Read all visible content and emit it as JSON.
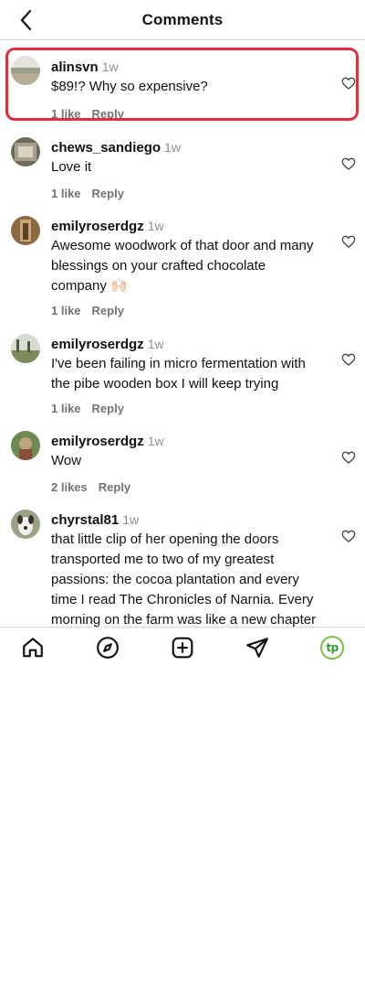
{
  "header": {
    "title": "Comments"
  },
  "comments": [
    {
      "username": "alinsvn",
      "time": "1w",
      "text": "$89!? Why so expensive?",
      "likes": "1 like",
      "reply": "Reply"
    },
    {
      "username": "chews_sandiego",
      "time": "1w",
      "text": "Love it",
      "likes": "1 like",
      "reply": "Reply"
    },
    {
      "username": "emilyroserdgz",
      "time": "1w",
      "text": "Awesome woodwork of that door and many blessings on your crafted chocolate company 🙌🏻",
      "likes": "1 like",
      "reply": "Reply"
    },
    {
      "username": "emilyroserdgz",
      "time": "1w",
      "text": "I've been failing in micro fermentation with the pibe wooden box I will keep trying",
      "likes": "1 like",
      "reply": "Reply"
    },
    {
      "username": "emilyroserdgz",
      "time": "1w",
      "text": "Wow",
      "likes": "2 likes",
      "reply": "Reply"
    },
    {
      "username": "chyrstal81",
      "time": "1w",
      "text": "that little clip of her opening the doors transported me to two of my greatest passions: the cocoa plantation and every time I read The Chronicles of Narnia. Every morning on the farm was like a new chapter while I'm on this vacation fate",
      "likes": "",
      "reply": ""
    }
  ],
  "tabbar": {
    "items": [
      "home-icon",
      "explore-icon",
      "create-icon",
      "direct-message-icon",
      "profile-avatar"
    ],
    "profile_initials": "tp"
  },
  "colors": {
    "highlight": "#e0303c",
    "profile_ring": "#7ac143"
  }
}
